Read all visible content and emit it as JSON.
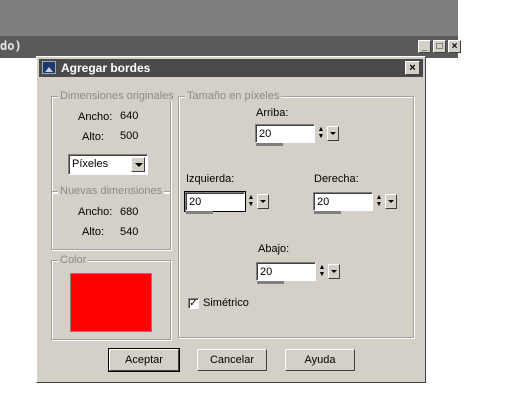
{
  "background": {
    "title_fragment": "do)",
    "ctrl_min": "_",
    "ctrl_max": "□",
    "ctrl_close": "×"
  },
  "dialog": {
    "title": "Agregar bordes",
    "close": "×",
    "original": {
      "legend": "Dimensiones originales",
      "width_label": "Ancho:",
      "width_value": "640",
      "height_label": "Alto:",
      "height_value": "500",
      "unit": "Píxeles"
    },
    "new": {
      "legend": "Nuevas dimensiones",
      "width_label": "Ancho:",
      "width_value": "680",
      "height_label": "Alto:",
      "height_value": "540"
    },
    "color": {
      "legend": "Color",
      "value": "#ff0000"
    },
    "size": {
      "legend": "Tamaño en píxeles",
      "top_label": "Arriba:",
      "top_value": "20",
      "left_label": "Izquierda:",
      "left_value": "20",
      "right_label": "Derecha:",
      "right_value": "20",
      "bottom_label": "Abajo:",
      "bottom_value": "20",
      "symmetric_label": "Simétrico",
      "symmetric_checked": true
    },
    "buttons": {
      "ok": "Aceptar",
      "cancel": "Cancelar",
      "help": "Ayuda"
    }
  }
}
